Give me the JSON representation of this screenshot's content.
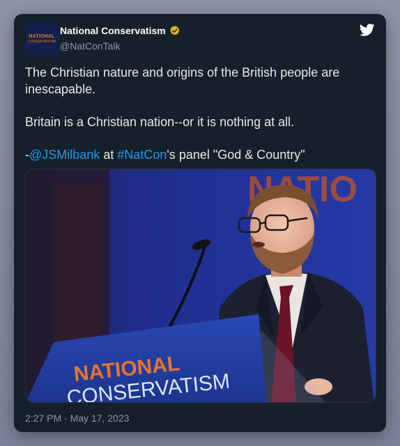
{
  "tweet": {
    "display_name": "National Conservatism",
    "handle": "@NatConTalk",
    "avatar_text_line1": "NATIONAL",
    "avatar_text_line2": "CONSERVATISM",
    "paragraph1": "The Christian nature and origins of the British people are inescapable.",
    "paragraph2": "Britain is a Christian nation--or it is nothing at all.",
    "p3_prefix": "-",
    "p3_mention": "@JSMilbank",
    "p3_mid": " at ",
    "p3_hashtag": "#NatCon",
    "p3_suffix": "'s panel \"God & Country\"",
    "timestamp": "2:27 PM · May 17, 2023",
    "media": {
      "backdrop_text": "NATIO",
      "podium_line1": "NATIONAL",
      "podium_line2": "CONSERVATISM"
    }
  },
  "icons": {
    "verified": "verified-badge-icon",
    "platform": "bird-logo-icon"
  },
  "colors": {
    "card_bg": "#15202b",
    "link": "#1d9bf0",
    "verified_gold": "#e2b719",
    "brand_orange": "#e8762b",
    "text": "#e7e9ea",
    "muted": "#8b98a5"
  }
}
